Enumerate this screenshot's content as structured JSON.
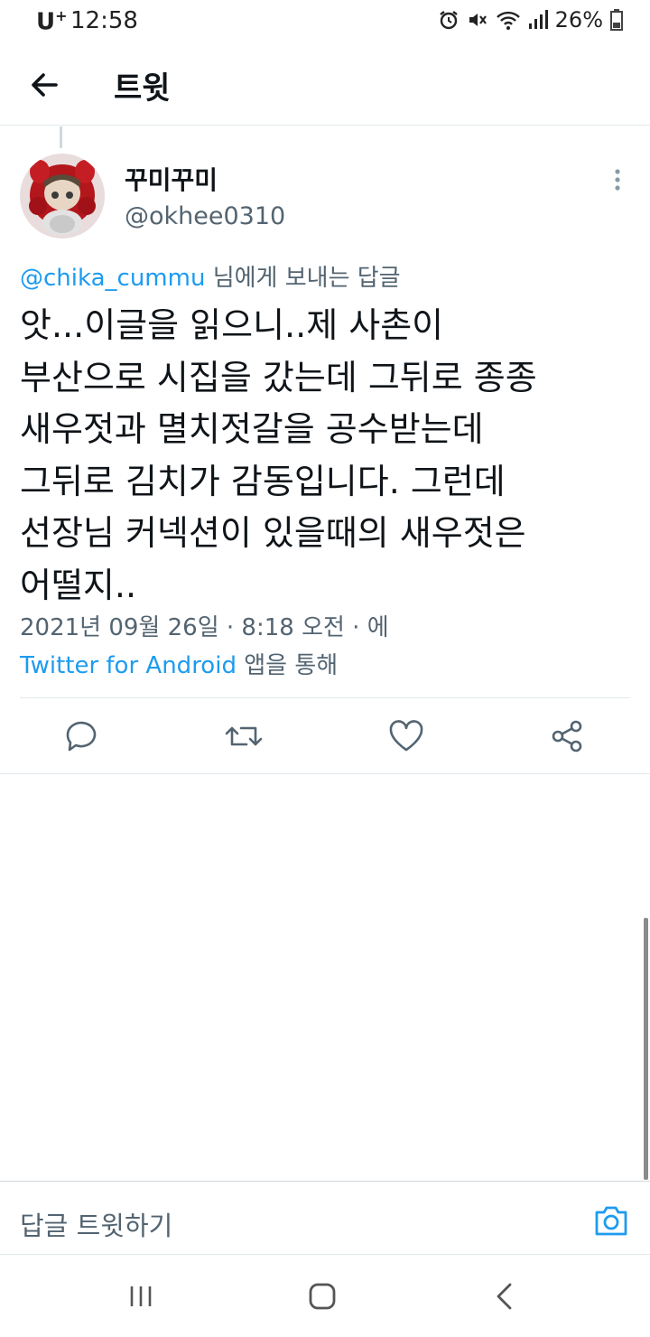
{
  "status_bar": {
    "carrier": "U",
    "carrier_sup": "+",
    "time": "12:58",
    "battery": "26%"
  },
  "header": {
    "title": "트윗"
  },
  "tweet": {
    "display_name": "꾸미꾸미",
    "handle": "@okhee0310",
    "reply_mention": "@chika_cummu",
    "reply_suffix": " 님에게 보내는 답글",
    "lines": [
      "앗...이글을 읽으니..제 사촌이",
      "부산으로 시집을 갔는데 그뒤로 종종",
      "새우젓과 멸치젓갈을 공수받는데",
      "그뒤로 김치가 감동입니다. 그런데",
      "선장님 커넥션이 있을때의 새우젓은",
      "어떨지.."
    ],
    "meta": "2021년 09월 26일 · 8:18 오전 · 에",
    "source_app": "Twitter for Android",
    "source_suffix": " 앱을 통해"
  },
  "reply_bar": {
    "placeholder": "답글 트윗하기"
  },
  "colors": {
    "accent": "#1d9bf0",
    "secondary_text": "#536471",
    "primary_text": "#0f1419"
  }
}
